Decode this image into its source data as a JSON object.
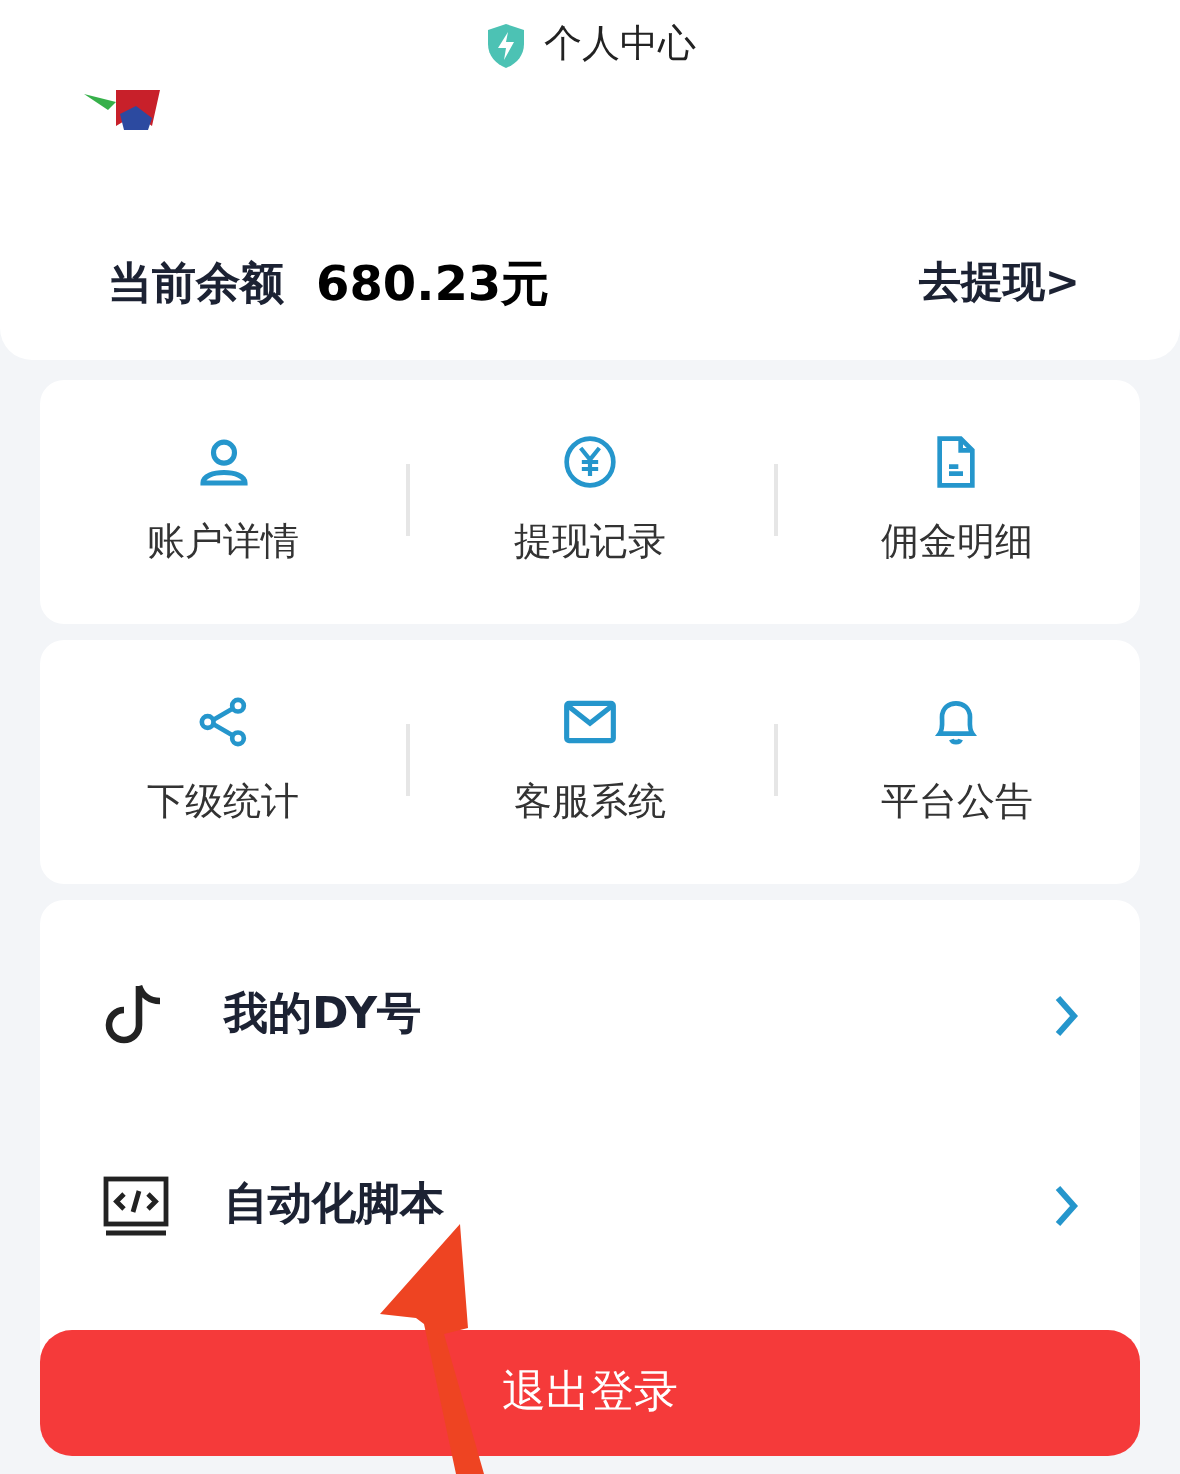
{
  "header": {
    "title": "个人中心"
  },
  "balance": {
    "label": "当前余额",
    "amount": "680.23元",
    "action": "去提现>"
  },
  "grid_1": [
    {
      "kind": "user",
      "label": "账户详情"
    },
    {
      "kind": "yuan",
      "label": "提现记录"
    },
    {
      "kind": "doc",
      "label": "佣金明细"
    }
  ],
  "grid_2": [
    {
      "kind": "share",
      "label": "下级统计"
    },
    {
      "kind": "mail",
      "label": "客服系统"
    },
    {
      "kind": "bell",
      "label": "平台公告"
    }
  ],
  "menu": [
    {
      "kind": "note",
      "label": "我的DY号"
    },
    {
      "kind": "code",
      "label": "自动化脚本"
    }
  ],
  "logout_button": "退出登录"
}
